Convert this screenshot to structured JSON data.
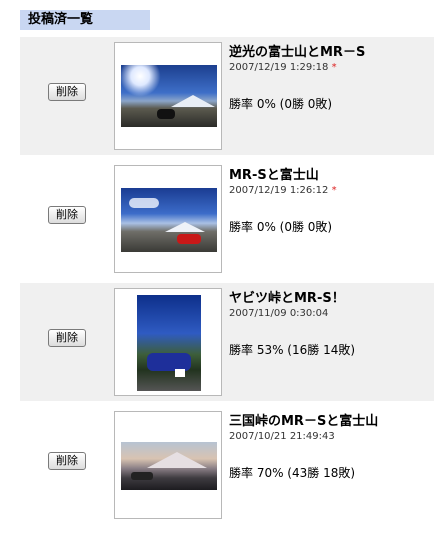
{
  "header": {
    "title": "投稿済一覧"
  },
  "posts": [
    {
      "delete_label": "削除",
      "title": "逆光の富士山とMR－S",
      "date": "2007/12/19 1:29:18",
      "star": "*",
      "rate": "勝率 0% (0勝 0敗)"
    },
    {
      "delete_label": "削除",
      "title": "MR-Sと富士山",
      "date": "2007/12/19 1:26:12",
      "star": "*",
      "rate": "勝率 0% (0勝 0敗)"
    },
    {
      "delete_label": "削除",
      "title": "ヤビツ峠とMR-S！",
      "date": "2007/11/09 0:30:04",
      "star": "",
      "rate": "勝率 53% (16勝 14敗)"
    },
    {
      "delete_label": "削除",
      "title": "三国峠のMR－Sと富士山",
      "date": "2007/10/21 21:49:43",
      "star": "",
      "rate": "勝率 70% (43勝 18敗)"
    }
  ],
  "colors": {
    "header_bg": "#c9d7f2",
    "row_bg": "#f0f0f0",
    "star": "#dd2222"
  }
}
